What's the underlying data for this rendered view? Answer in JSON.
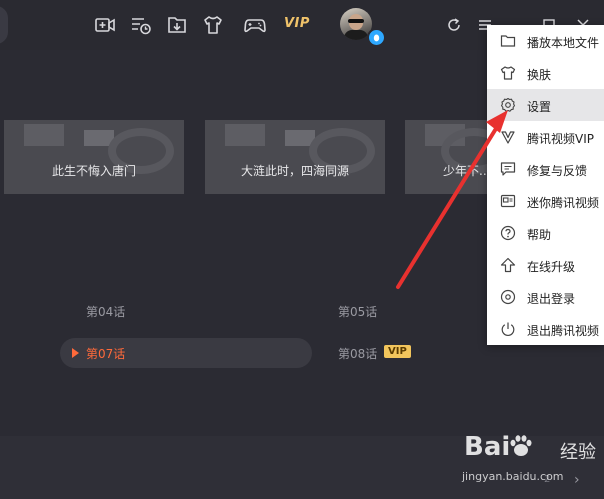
{
  "colors": {
    "bg": "#2b2b33",
    "accent_orange": "#ff6a3b",
    "vip_gold": "#f0c36a",
    "menu_bg": "#ffffff",
    "menu_highlight": "#e6e6e8",
    "arrow_red": "#e8312f"
  },
  "topbar": {
    "icons": [
      "video-camera-icon",
      "playlist-history-icon",
      "download-icon",
      "tshirt-skin-icon",
      "gamepad-icon"
    ],
    "vip_label": "VIP",
    "avatar": "user-avatar",
    "qq_badge_icon": "qq-penguin-icon",
    "window_controls": [
      "refresh-icon",
      "menu-icon",
      "minimize-icon",
      "close-icon"
    ]
  },
  "thumbnails": [
    {
      "caption": "此生不悔入唐门"
    },
    {
      "caption": "大涟此时，四海同源"
    },
    {
      "caption": "少年不..."
    }
  ],
  "episodes": {
    "ep04": "第04话",
    "ep05": "第05话",
    "ep07": "第07话",
    "ep08": "第08话",
    "vip_badge": "VIP"
  },
  "menu": {
    "items": [
      {
        "label": "播放本地文件",
        "icon": "folder-icon"
      },
      {
        "label": "换肤",
        "icon": "tshirt-icon"
      },
      {
        "label": "设置",
        "icon": "gear-icon"
      },
      {
        "label": "腾讯视频VIP",
        "icon": "vip-v-icon"
      },
      {
        "label": "修复与反馈",
        "icon": "feedback-icon"
      },
      {
        "label": "迷你腾讯视频",
        "icon": "mini-window-icon"
      },
      {
        "label": "帮助",
        "icon": "help-icon"
      },
      {
        "label": "在线升级",
        "icon": "upgrade-icon"
      },
      {
        "label": "退出登录",
        "icon": "logout-icon"
      },
      {
        "label": "退出腾讯视频",
        "icon": "power-icon"
      }
    ],
    "highlighted_index": 2
  },
  "bottom": {
    "page_fragment": "2"
  },
  "watermark": {
    "logo_text": "Bai",
    "logo_text2": "经验",
    "url": "jingyan.baidu.com"
  }
}
